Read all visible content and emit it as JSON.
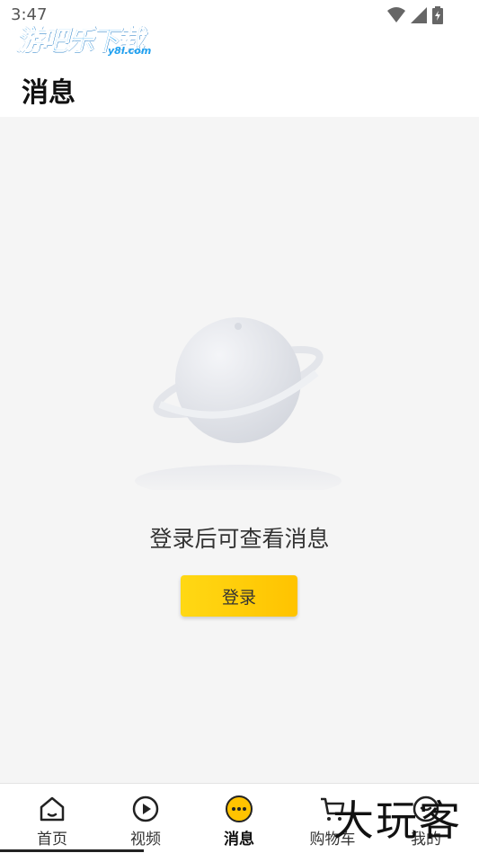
{
  "status_bar": {
    "time": "3:47"
  },
  "watermark": {
    "brand": "游吧乐下载",
    "domain": "y8l.com"
  },
  "header": {
    "title": "消息"
  },
  "empty_state": {
    "message": "登录后可查看消息",
    "login_label": "登录"
  },
  "tabs": [
    {
      "label": "首页",
      "icon": "home-icon",
      "active": false
    },
    {
      "label": "视频",
      "icon": "play-icon",
      "active": false
    },
    {
      "label": "消息",
      "icon": "chat-icon",
      "active": true
    },
    {
      "label": "购物车",
      "icon": "cart-icon",
      "active": false
    },
    {
      "label": "我的",
      "icon": "user-icon",
      "active": false
    }
  ],
  "overlay": {
    "text": "大玩客"
  },
  "colors": {
    "accent": "#ffc300",
    "background": "#f5f5f5",
    "brand_blue": "#1ea0f0"
  }
}
